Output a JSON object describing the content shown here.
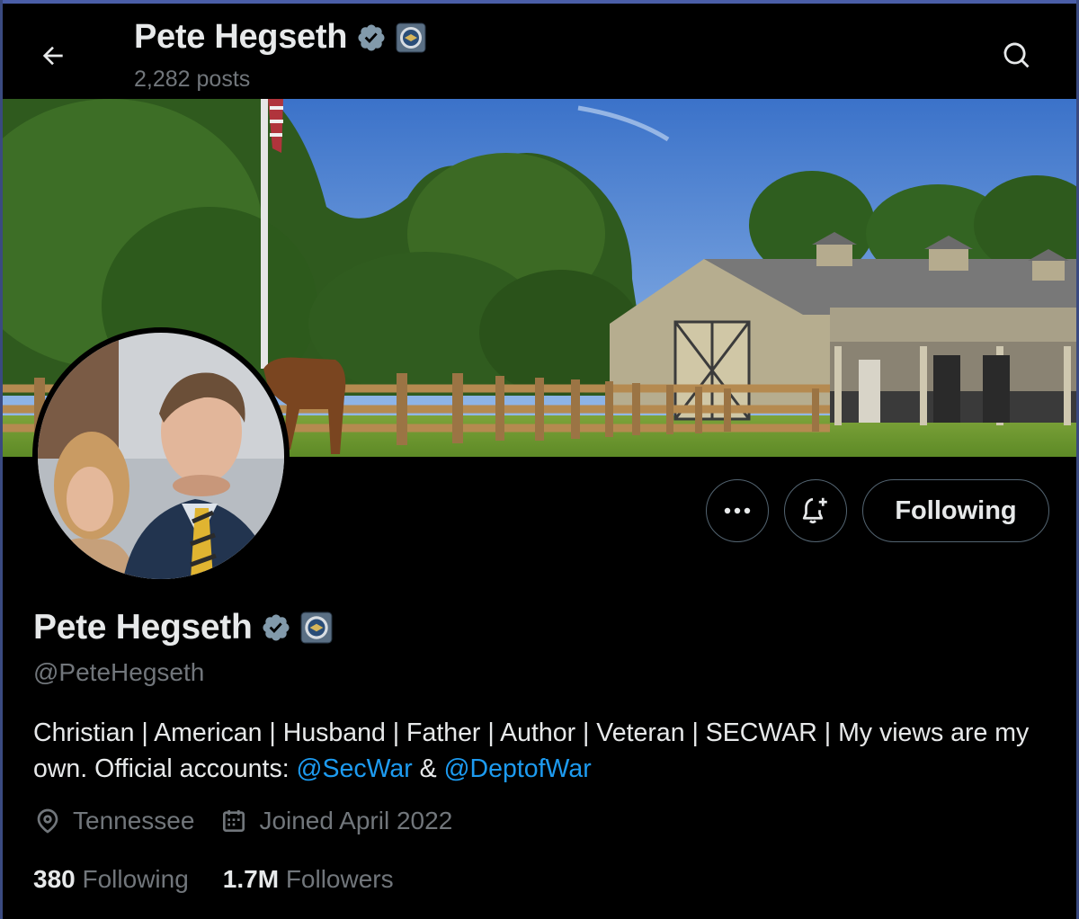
{
  "header": {
    "name": "Pete Hegseth",
    "posts": "2,282 posts"
  },
  "profile": {
    "name": "Pete Hegseth",
    "handle": "@PeteHegseth",
    "bio_text": "Christian | American | Husband | Father | Author | Veteran | SECWAR | My views are my own. Official accounts: ",
    "bio_link_1": "@SecWar",
    "bio_between": " & ",
    "bio_link_2": "@DeptofWar",
    "location": "Tennessee",
    "joined": "Joined April 2022",
    "following_count": "380",
    "following_label": "Following",
    "followers_count": "1.7M",
    "followers_label": "Followers"
  },
  "actions": {
    "more_label": "•••",
    "follow_label": "Following"
  },
  "icons": {
    "back": "back-arrow-icon",
    "search": "search-icon",
    "verified": "verified-badge-icon",
    "affiliate": "dow-seal-icon",
    "notify": "bell-plus-icon",
    "location": "location-pin-icon",
    "calendar": "calendar-icon"
  },
  "colors": {
    "background": "#000000",
    "text": "#e7e9ea",
    "muted": "#71767b",
    "link": "#1d9bf0",
    "border": "#536471"
  }
}
